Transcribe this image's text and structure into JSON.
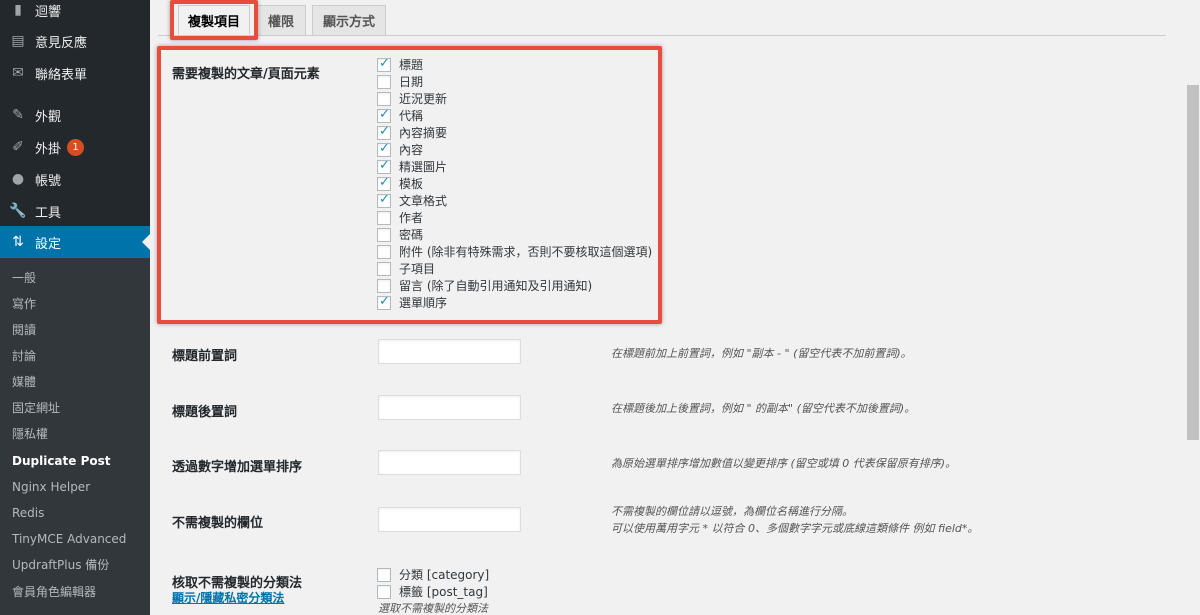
{
  "sidebar": {
    "items": [
      {
        "label": "迴響",
        "icon": "comment-icon",
        "glyph": "▮"
      },
      {
        "label": "意見反應",
        "icon": "form-icon",
        "glyph": "▤"
      },
      {
        "label": "聯絡表單",
        "icon": "mail-icon",
        "glyph": "✉"
      },
      {
        "label": "外觀",
        "icon": "brush-icon",
        "glyph": "✎"
      },
      {
        "label": "外掛",
        "icon": "plugin-icon",
        "glyph": "✐",
        "badge": "1"
      },
      {
        "label": "帳號",
        "icon": "user-icon",
        "glyph": "●"
      },
      {
        "label": "工具",
        "icon": "wrench-icon",
        "glyph": "🔧"
      },
      {
        "label": "設定",
        "icon": "settings-icon",
        "glyph": "⇅",
        "current": true
      }
    ],
    "submenu": [
      "一般",
      "寫作",
      "閱讀",
      "討論",
      "媒體",
      "固定網址",
      "隱私權",
      "Duplicate Post",
      "Nginx Helper",
      "Redis",
      "TinyMCE Advanced",
      "UpdraftPlus 備份",
      "會員角色編輯器"
    ],
    "submenu_current": "Duplicate Post"
  },
  "tabs": [
    "複製項目",
    "權限",
    "顯示方式"
  ],
  "elements_section": {
    "label": "需要複製的文章/頁面元素",
    "options": [
      {
        "label": "標題",
        "checked": true
      },
      {
        "label": "日期",
        "checked": false
      },
      {
        "label": "近況更新",
        "checked": false
      },
      {
        "label": "代稱",
        "checked": true
      },
      {
        "label": "內容摘要",
        "checked": true
      },
      {
        "label": "內容",
        "checked": true
      },
      {
        "label": "精選圖片",
        "checked": true
      },
      {
        "label": "模板",
        "checked": true
      },
      {
        "label": "文章格式",
        "checked": true
      },
      {
        "label": "作者",
        "checked": false
      },
      {
        "label": "密碼",
        "checked": false
      },
      {
        "label": "附件 (除非有特殊需求，否則不要核取這個選項)",
        "checked": false
      },
      {
        "label": "子項目",
        "checked": false
      },
      {
        "label": "留言 (除了自動引用通知及引用通知)",
        "checked": false
      },
      {
        "label": "選單順序",
        "checked": true
      }
    ]
  },
  "fields": [
    {
      "label": "標題前置詞",
      "value": "",
      "desc": "在標題前加上前置詞，例如 \"副本 - \" (留空代表不加前置詞)。"
    },
    {
      "label": "標題後置詞",
      "value": "",
      "desc": "在標題後加上後置詞，例如 \" 的副本\" (留空代表不加後置詞)。"
    },
    {
      "label": "透過數字增加選單排序",
      "value": "",
      "desc": "為原始選單排序增加數值以變更排序 (留空或填 0 代表保留原有排序)。"
    },
    {
      "label": "不需複製的欄位",
      "value": "",
      "desc": "不需複製的欄位請以逗號，為欄位名稱進行分隔。",
      "desc2": "可以使用萬用字元 * 以符合 0、多個數字字元或底線這類條件 例如 field*。"
    }
  ],
  "taxonomy": {
    "label": "核取不需複製的分類法",
    "link": "顯示/隱藏私密分類法",
    "options": [
      {
        "label": "分類 [category]",
        "checked": false
      },
      {
        "label": "標籤 [post_tag]",
        "checked": false
      }
    ],
    "hint": "選取不需複製的分類法"
  },
  "colors": {
    "accent": "#0073aa",
    "highlight_box": "#e74c3c"
  }
}
